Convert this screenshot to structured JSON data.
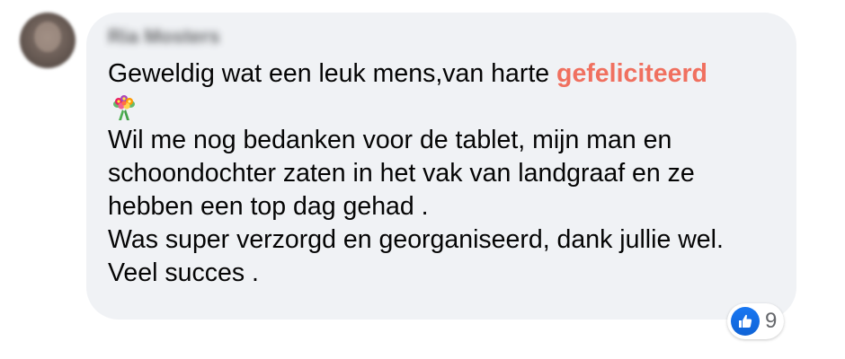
{
  "comment": {
    "author_name": "Ria Mosters",
    "lines": [
      "Geweldig wat een leuk mens,van harte",
      "Wil me nog bedanken voor de tablet, mijn man en",
      "schoondochter zaten in het vak van landgraaf en ze",
      "hebben een top dag gehad .",
      "Was super verzorgd en georganiseerd, dank jullie wel.",
      "Veel succes ."
    ],
    "mention": "gefeliciteerd",
    "emoji": "bouquet-icon"
  },
  "reactions": {
    "icon": "like-icon",
    "count": "9",
    "color": "#1877f2"
  },
  "colors": {
    "bubble": "#f0f2f5",
    "text": "#050505",
    "mention": "#f0705f"
  }
}
